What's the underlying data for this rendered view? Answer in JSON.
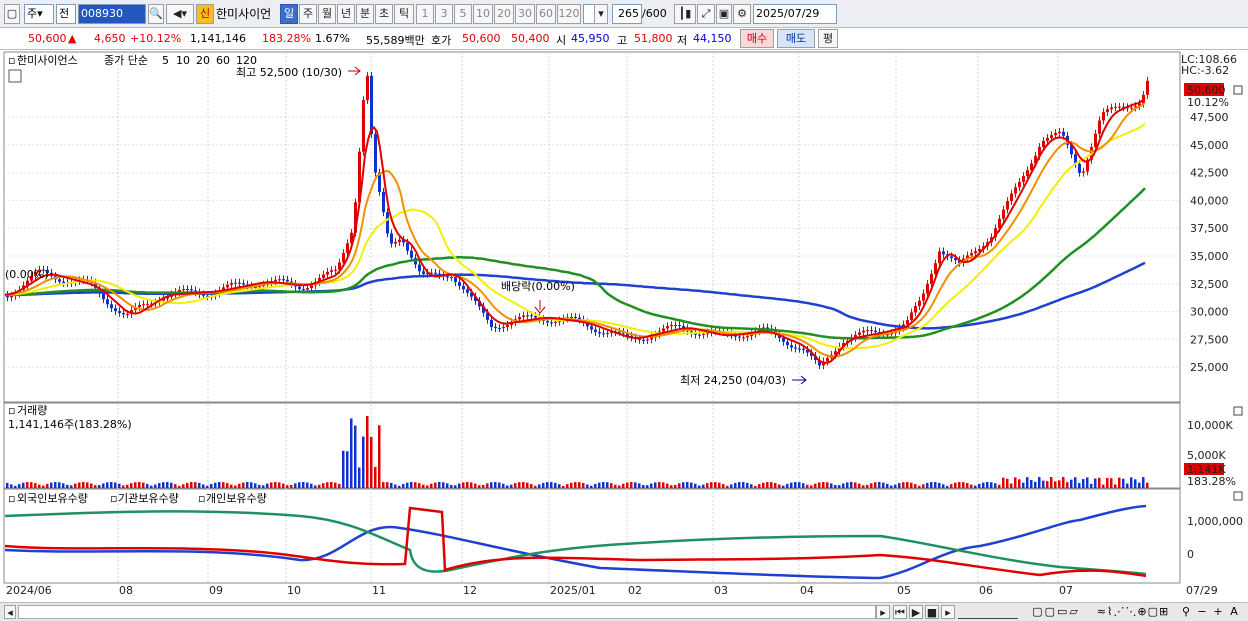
{
  "toolbar": {
    "type_label": "주",
    "period_label": "전",
    "stock_code": "008930",
    "new_badge": "신",
    "stock_name": "한미사이언",
    "period_tabs": [
      "일",
      "주",
      "월",
      "년",
      "분",
      "초",
      "틱"
    ],
    "interval_tabs": [
      "1",
      "3",
      "5",
      "10",
      "20",
      "30",
      "60",
      "120"
    ],
    "count_value": "265",
    "count_total": "/600",
    "date_value": "2025/07/29"
  },
  "quote": {
    "price": "50,600",
    "change": "4,650",
    "change_pct": "+10.12%",
    "volume": "1,141,146",
    "volume_ratio": "183.28%",
    "turnover": "1.67%",
    "amount": "55,589백만",
    "ask_label": "호가",
    "ask": "50,600",
    "bid": "50,400",
    "open_label": "시",
    "open": "45,950",
    "high_label": "고",
    "high": "51,800",
    "low_label": "저",
    "low": "44,150",
    "buy_btn": "매수",
    "sell_btn": "매도",
    "eval_btn": "평"
  },
  "price_pane": {
    "stock_name": "한미사이언스",
    "legend_prefix": "종가 단순",
    "ma_periods": [
      "5",
      "10",
      "20",
      "60",
      "120"
    ],
    "ma_colors": [
      "#e00000",
      "#f09000",
      "#f0f000",
      "#209020",
      "#2040d0"
    ],
    "lc": "LC:108.66",
    "hc": "HC:-3.62",
    "last_price": "50,600",
    "last_pct": "10.12%",
    "high_note": "최고 52,500 (10/30)",
    "low_note": "최저 24,250 (04/03)",
    "dividend_note": "배당락(0.00%)",
    "left_note": "(0.00%)",
    "y_ticks": [
      "47,500",
      "45,000",
      "42,500",
      "40,000",
      "37,500",
      "35,000",
      "32,500",
      "30,000",
      "27,500",
      "25,000"
    ]
  },
  "volume_pane": {
    "title": "거래량",
    "current": "1,141,146주(183.28%)",
    "y_ticks": [
      "10,000K",
      "5,000K"
    ],
    "last_value": "1,141K",
    "last_pct": "183.28%"
  },
  "holding_pane": {
    "legend": [
      "외국인보유수량",
      "기관보유수량",
      "개인보유수량"
    ],
    "y_ticks": [
      "1,000,000",
      "0"
    ]
  },
  "x_axis": {
    "labels": [
      "2024/06",
      "08",
      "09",
      "10",
      "11",
      "12",
      "2025/01",
      "02",
      "03",
      "04",
      "05",
      "06",
      "07"
    ],
    "last_label": "07/29"
  }
}
